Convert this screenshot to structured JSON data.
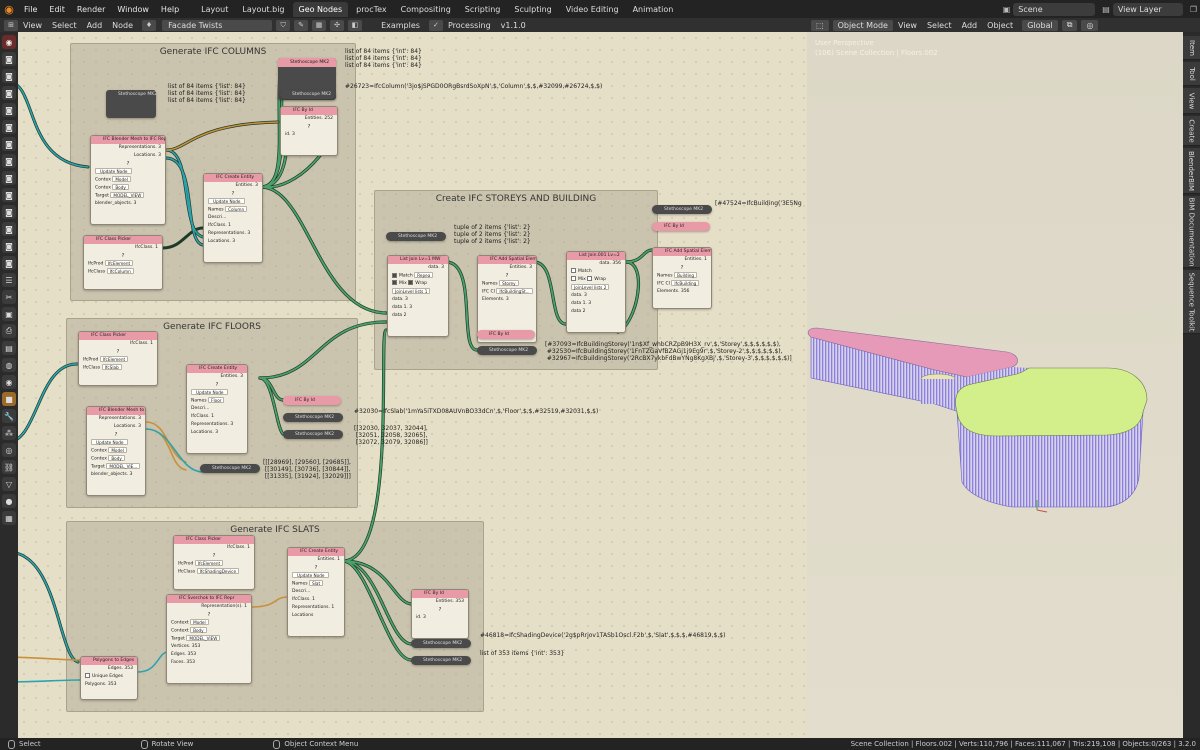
{
  "topbar": {
    "menus": [
      "File",
      "Edit",
      "Render",
      "Window",
      "Help"
    ],
    "workspaces": [
      "Layout",
      "Layout.big",
      "Geo Nodes",
      "procTex",
      "Compositing",
      "Scripting",
      "Sculpting",
      "Video Editing",
      "Animation"
    ],
    "active_workspace": "Geo Nodes",
    "scene": "Scene",
    "view_layer": "View Layer"
  },
  "node_editor": {
    "menus": [
      "View",
      "Select",
      "Add",
      "Node"
    ],
    "tree_name": "Facade Twists",
    "examples_label": "Examples",
    "processing_label": "Processing",
    "version": "v1.1.0"
  },
  "viewport": {
    "mode": "Object Mode",
    "menus": [
      "View",
      "Select",
      "Add",
      "Object"
    ],
    "orientation": "Global",
    "overlay_title": "User Perspective",
    "overlay_collection": "(106) Scene Collection | Floors.002",
    "colors": {
      "roof_pink": "#e79ab8",
      "roof_green": "#d2ef8c",
      "slats": "#8c7fe0"
    }
  },
  "side_tabs": [
    "Item",
    "Tool",
    "View",
    "Create",
    "BlenderBIM",
    "BIM Documentation",
    "Sequence Toolkit"
  ],
  "frames": {
    "columns": "Generate IFC COLUMNS",
    "storeys": "Create IFC STOREYS AND BUILDING",
    "floors": "Generate IFC FLOORS",
    "slats": "Generate IFC SLATS"
  },
  "nodes": {
    "stetho_mk2_a": "Stethoscope MK2",
    "stetho_mk2_b": "Stethoscope MK2",
    "stetho_mk2_c": "Stethoscope MK2",
    "blender_mesh_cols": {
      "title": "IFC Blender Mesh to IFC Repr",
      "representations": "Representations. 3",
      "locations": "Locations. 3",
      "update": "Update Node",
      "context_label": "Contex",
      "context_val": "Model",
      "context2_val": "Body",
      "target_label": "Target",
      "target_val": "MODEL_VIEW",
      "out": "blender_objects. 3"
    },
    "class_picker_cols": {
      "title": "IFC Class Picker",
      "ifcclass": "IfcClass. 1",
      "prod_label": "IfcProd",
      "prod_val": "IfcElement",
      "class_label": "IfcClass",
      "class_val": "IfcColumn"
    },
    "create_entity_cols": {
      "title": "IFC Create Entity",
      "entities": "Entities. 3",
      "update": "Update Node",
      "names": "Names",
      "names_val": "Column",
      "descr": "Descri...",
      "ifcclass": "IfcClass. 1",
      "reps": "Representations. 3",
      "locs": "Locations. 3"
    },
    "byid_cols": {
      "title": "IFC By Id",
      "entities": "Entities. 252",
      "id": "id. 3"
    },
    "stetho_top": "Stethoscope MK2",
    "listjoin_a": {
      "title": "List Join Lv=1 MW",
      "data": "data. 3",
      "match": "Match",
      "repeat": "Repea",
      "mix": "Mix",
      "wrap": "Wrap",
      "joinlevel": "JoinLevel lists",
      "joinlevel_val": "1",
      "in1": "data. 3",
      "in2": "data 1. 3",
      "in3": "data 2"
    },
    "add_spatial_a": {
      "title": "IFC Add Spatial Elem...",
      "entities": "Entities. 3",
      "names": "Names",
      "names_val": "Storey",
      "ifccl": "IFC Cl",
      "ifccl_val": "IfcBuildingSt...",
      "elements": "Elements. 3"
    },
    "listjoin_b": {
      "title": "List Join.001 Lv=2",
      "data": "data. 356",
      "match": "Match",
      "mix": "Mix",
      "wrap": "Wrap",
      "joinlevel": "JoinLevel lists",
      "joinlevel_val": "2",
      "in1": "data. 3",
      "in2": "data 1. 3",
      "in3": "data 2"
    },
    "add_spatial_b": {
      "title": "IFC Add Spatial Eleme",
      "entities": "Entities. 1",
      "names": "Names",
      "names_val": "Building",
      "ifccl": "IFC Cl",
      "ifccl_val": "IfcBuilding",
      "elements": "Elements. 356"
    },
    "byid_storey": "IFC By Id",
    "byid_building": "IFC By Id",
    "class_picker_floors": {
      "title": "IFC Class Picker",
      "ifcclass": "IfcClass. 1",
      "prod_label": "IfcProd",
      "prod_val": "IfcElement",
      "class_label": "IfcClass",
      "class_val": "IfcSlab"
    },
    "create_entity_floors": {
      "title": "IFC Create Entity",
      "entities": "Entities. 3",
      "update": "Update Node",
      "names": "Names",
      "names_val": "Floor",
      "descr": "Descri...",
      "ifcclass": "IfcClass. 1",
      "reps": "Representations. 3",
      "locs": "Locations. 3"
    },
    "blender_mesh_floors": {
      "title": "IFC Blender Mesh to I...",
      "representations": "Representations. 3",
      "locations": "Locations. 3",
      "update": "Update Node",
      "context_label": "Contex",
      "context_val": "Model",
      "context2_val": "Body",
      "target_label": "Target",
      "target_val": "MODEL_VIE...",
      "out": "blender_objects. 3"
    },
    "byid_floors": "IFC By Id",
    "class_picker_slats": {
      "title": "IFC Class Picker",
      "ifcclass": "IfcClass. 1",
      "prod_label": "IfcProd",
      "prod_val": "IfcElement",
      "class_label": "IfcClass",
      "class_val": "IfcShadingDevice"
    },
    "svverts_slats": {
      "title": "IFC Sverchok to IFC Repr",
      "reps": "Representation(s). 1",
      "context_label": "Context",
      "context_val": "Model",
      "context2_val": "Body",
      "target_label": "Target",
      "target_val": "MODEL_VIEW",
      "verts": "Vertices. 353",
      "edges": "Edges. 353",
      "faces": "Faces. 353"
    },
    "create_entity_slats": {
      "title": "IFC Create Entity",
      "entities": "Entities. 1",
      "update": "Update Node",
      "names": "Names",
      "names_val": "Slat",
      "descr": "Descri...",
      "ifcclass": "IfcClass. 1",
      "reps": "Representations. 1",
      "locs": "Locations"
    },
    "byid_slats": {
      "title": "IFC By Id",
      "entities": "Entities. 353",
      "id": "id. 3"
    },
    "poly_edges": {
      "title": "Polygons to Edges",
      "edges": "Edges. 353",
      "unique": "Unique Edges",
      "polygons": "Polygons. 353"
    }
  },
  "canvas_text": {
    "cols_list_right": "list of 84 items {'int': 84}\nlist of 84 items {'int': 84}\nlist of 84 items {'int': 84}",
    "cols_ifc_column": "#26723=IfcColumn('3jo$jSPGD0ORgBsrdSoXpN',$,'Column',$,$,#32099,#26724,$,$)",
    "cols_list_left": "list of 84 items {'list': 84}\nlist of 84 items {'list': 84}\nlist of 84 items {'list': 84}",
    "tuple_text": "tuple of 2 items {'list': 2}\ntuple of 2 items {'list': 2}\ntuple of 2 items {'list': 2}",
    "ifc_building": "[#47524=IfcBuilding('3E5Ng",
    "ifc_storeys": "[#37093=IfcBuildingStorey('1n$Xf_whbCRZpB9H3X_rv',$,'Storey',$,$,$,$,$,$),\n #32530=IfcBuildingStorey('1FnTZGaVfBZAGj1j9Eg9r',$,'Storey-2',$,$,$,$,$,$),\n #32967=IfcBuildingStorey('2RcBX7ykbFdBwYNg8KgXBj',$,'Storey-3',$,$,$,$,$,$)]",
    "ifc_slab": "#32030=IfcSlab('1mYa5iTXD08AUVnBO33dCn',$,'Floor',$,$,#32519,#32031,$,$)",
    "floors_lists1": "[[32030, 32037, 32044],\n [32051, 32058, 32065],\n [32072, 32079, 32086]]",
    "floors_lists2": "[[[28969], [29560], [29685]],\n [[30149], [30736], [30844]],\n [[31335], [31924], [32029]]]",
    "ifc_shading": "#46818=IfcShadingDevice('2g$pRrjov1TASb1Oscl.F2b',$,'Slat',$,$,$,#46819,$,$)",
    "slats_list": "list of 353 items {'int': 353}"
  },
  "statusbar": {
    "select": "Select",
    "rotate": "Rotate View",
    "context": "Object Context Menu",
    "stats": "Scene Collection | Floors.002 | Verts:110,796 | Faces:111,067 | Tris:219,108 | Objects:0/263 | 3.2.0"
  }
}
